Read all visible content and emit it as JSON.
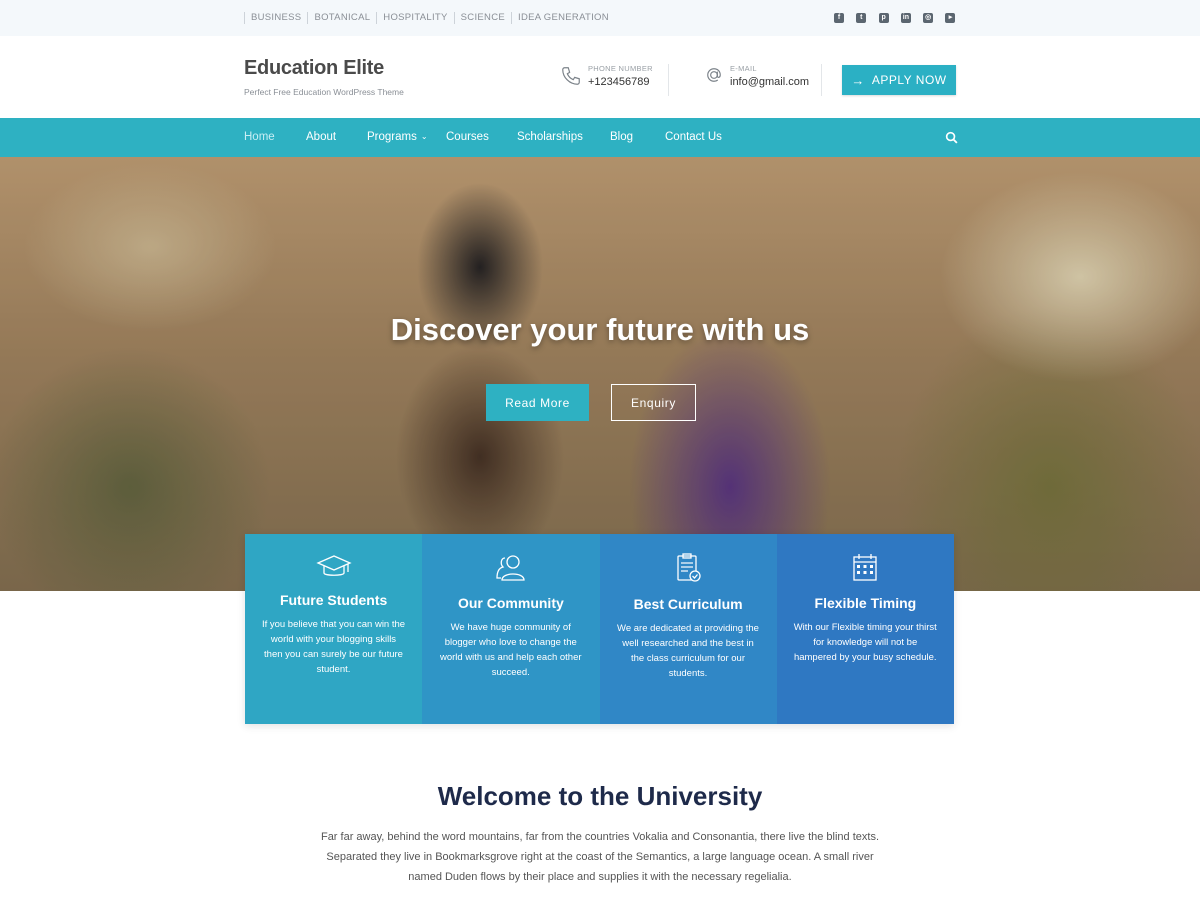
{
  "topbar": {
    "categories": [
      "BUSINESS",
      "BOTANICAL",
      "HOSPITALITY",
      "SCIENCE",
      "IDEA GENERATION"
    ],
    "social_icons": [
      "facebook-icon",
      "twitter-icon",
      "pinterest-icon",
      "linkedin-icon",
      "instagram-icon",
      "youtube-icon"
    ]
  },
  "header": {
    "title": "Education Elite",
    "tagline": "Perfect Free Education WordPress Theme",
    "phone": {
      "label": "PHONE NUMBER",
      "value": "+123456789",
      "icon": "phone-icon"
    },
    "email": {
      "label": "E-MAIL",
      "value": "info@gmail.com",
      "icon": "at-icon"
    },
    "apply_label": "APPLY NOW"
  },
  "nav": {
    "items": [
      "Home",
      "About",
      "Programs",
      "Courses",
      "Scholarships",
      "Blog",
      "Contact Us"
    ],
    "active": "Home",
    "search_icon": "search-icon"
  },
  "hero": {
    "heading": "Discover your future with us",
    "primary_button": "Read More",
    "secondary_button": "Enquiry"
  },
  "features": [
    {
      "title": "Future Students",
      "icon": "graduation-cap-icon",
      "description": "If you believe that you can win the world with your blogging skills then you can surely be our future student."
    },
    {
      "title": "Our Community",
      "icon": "users-icon",
      "description": "We have huge community of blogger who love to change the world with us and help each other succeed."
    },
    {
      "title": "Best Curriculum",
      "icon": "clipboard-check-icon",
      "description": "We are dedicated at providing the well researched and the best in the class curriculum for our students."
    },
    {
      "title": "Flexible Timing",
      "icon": "calendar-icon",
      "description": "With our Flexible timing your thirst for knowledge will not be hampered by your busy schedule."
    }
  ],
  "colors": {
    "accent": "#2eb1c2",
    "feature_1": "#2fa6c4",
    "feature_2": "#2f95c6",
    "feature_3": "#3087c6",
    "feature_4": "#2f78c2",
    "heading_dark": "#1e2a4a"
  },
  "welcome": {
    "title": "Welcome to the University",
    "text": "Far far away, behind the word mountains, far from the countries Vokalia and Consonantia, there live the blind texts. Separated they live in Bookmarksgrove right at the coast of the Semantics, a large language ocean. A small river named Duden flows by their place and supplies it with the necessary regelialia."
  }
}
